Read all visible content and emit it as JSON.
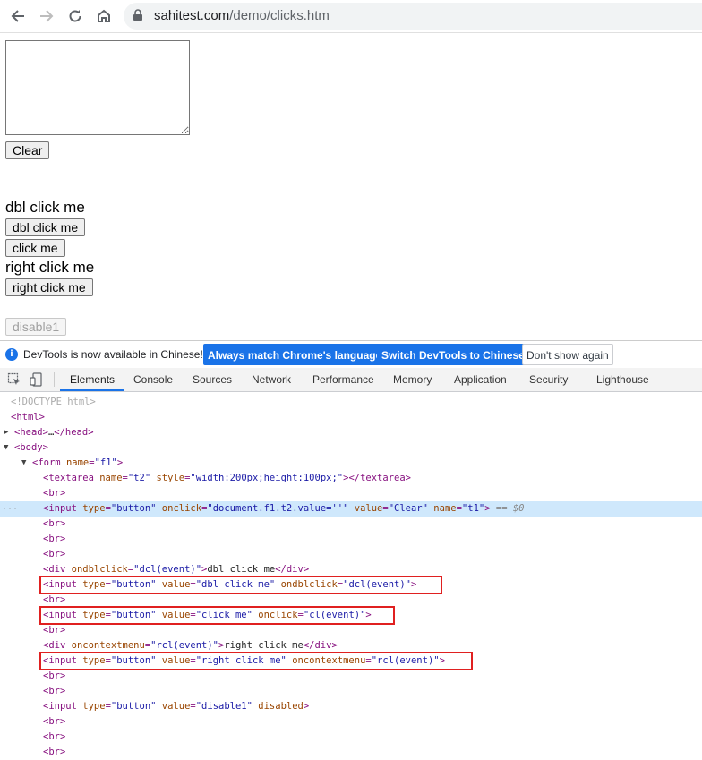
{
  "browser": {
    "url_host": "sahitest.com",
    "url_path": "/demo/clicks.htm"
  },
  "page": {
    "clear_button": "Clear",
    "dbl_text": "dbl click me",
    "dbl_button": "dbl click me",
    "click_button": "click me",
    "right_text": "right click me",
    "right_button": "right click me",
    "disable_button": "disable1"
  },
  "infobar": {
    "message": "DevTools is now available in Chinese!",
    "match_button": "Always match Chrome's language",
    "switch_button": "Switch DevTools to Chinese",
    "dismiss_button": "Don't show again"
  },
  "devtools": {
    "tabs": [
      "Elements",
      "Console",
      "Sources",
      "Network",
      "Performance",
      "Memory",
      "Application",
      "Security",
      "Lighthouse"
    ],
    "active_tab": "Elements",
    "selected_suffix": "== $0"
  },
  "dom_lines": [
    "<!DOCTYPE html>",
    "<html>",
    "<head>…</head>",
    "<body>",
    "<form name=\"f1\">",
    "<textarea name=\"t2\" style=\"width:200px;height:100px;\"></textarea>",
    "<br>",
    "<input type=\"button\" onclick=\"document.f1.t2.value=''\" value=\"Clear\" name=\"t1\">",
    "<br>",
    "<br>",
    "<br>",
    "<div ondblclick=\"dcl(event)\">dbl click me</div>",
    "<input type=\"button\" value=\"dbl click me\" ondblclick=\"dcl(event)\">",
    "<br>",
    "<input type=\"button\" value=\"click me\" onclick=\"cl(event)\">",
    "<br>",
    "<div oncontextmenu=\"rcl(event)\">right click me</div>",
    "<input type=\"button\" value=\"right click me\" oncontextmenu=\"rcl(event)\">",
    "<br>",
    "<br>",
    "<input type=\"button\" value=\"disable1\" disabled>",
    "<br>",
    "<br>",
    "<br>"
  ]
}
